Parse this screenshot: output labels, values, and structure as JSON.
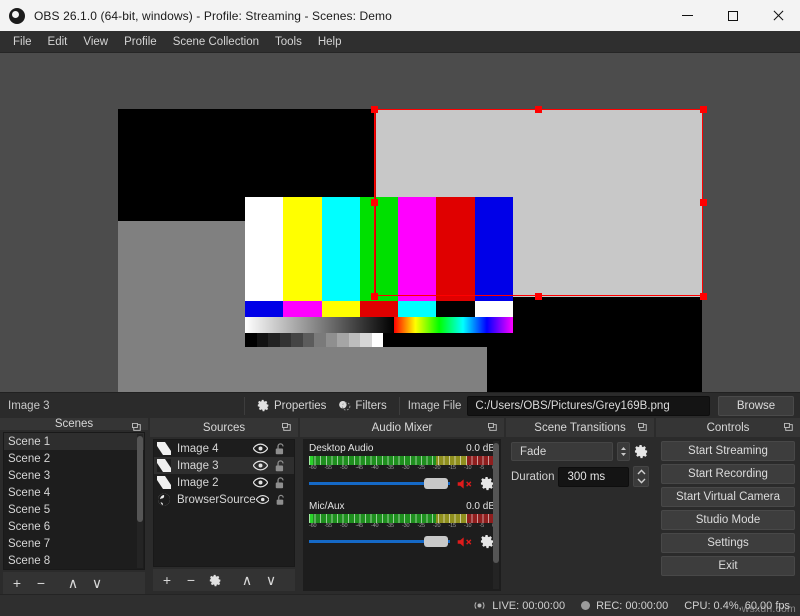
{
  "window": {
    "title": "OBS 26.1.0 (64-bit, windows) - Profile: Streaming - Scenes: Demo",
    "app_icon": "obs-logo-icon",
    "minimize_label": "—",
    "maximize_label": "□",
    "close_label": "✕"
  },
  "menubar": {
    "items": [
      {
        "label": "File"
      },
      {
        "label": "Edit"
      },
      {
        "label": "View"
      },
      {
        "label": "Profile"
      },
      {
        "label": "Scene Collection"
      },
      {
        "label": "Tools"
      },
      {
        "label": "Help"
      }
    ]
  },
  "source_toolbar": {
    "selected_source": "Image 3",
    "properties_label": "Properties",
    "filters_label": "Filters",
    "image_file_label": "Image File",
    "image_file_value": "C:/Users/OBS/Pictures/Grey169B.png",
    "browse_label": "Browse"
  },
  "scenes": {
    "title": "Scenes",
    "items": [
      {
        "label": "Scene 1",
        "selected": true
      },
      {
        "label": "Scene 2",
        "selected": false
      },
      {
        "label": "Scene 3",
        "selected": false
      },
      {
        "label": "Scene 4",
        "selected": false
      },
      {
        "label": "Scene 5",
        "selected": false
      },
      {
        "label": "Scene 6",
        "selected": false
      },
      {
        "label": "Scene 7",
        "selected": false
      },
      {
        "label": "Scene 8",
        "selected": false
      }
    ],
    "buttons": {
      "add": "+",
      "remove": "−",
      "up": "∧",
      "down": "∨"
    }
  },
  "sources": {
    "title": "Sources",
    "items": [
      {
        "label": "Image 4",
        "icon": "image-source-icon",
        "visible": true,
        "locked": false,
        "selected": false
      },
      {
        "label": "Image 3",
        "icon": "image-source-icon",
        "visible": true,
        "locked": false,
        "selected": true
      },
      {
        "label": "Image 2",
        "icon": "image-source-icon",
        "visible": true,
        "locked": false,
        "selected": false
      },
      {
        "label": "BrowserSource",
        "icon": "browser-source-icon",
        "visible": true,
        "locked": false,
        "selected": false
      }
    ],
    "buttons": {
      "add": "+",
      "remove": "−",
      "properties": "gear-icon",
      "up": "∧",
      "down": "∨"
    }
  },
  "audio_mixer": {
    "title": "Audio Mixer",
    "scale_labels": [
      "-60",
      "-55",
      "-50",
      "-45",
      "-40",
      "-35",
      "-30",
      "-25",
      "-20",
      "-15",
      "-10",
      "-5",
      "0"
    ],
    "tracks": [
      {
        "name": "Desktop Audio",
        "level": "0.0 dB",
        "muted": true,
        "volume_percent": 100
      },
      {
        "name": "Mic/Aux",
        "level": "0.0 dB",
        "muted": true,
        "volume_percent": 100
      }
    ]
  },
  "scene_transitions": {
    "title": "Scene Transitions",
    "transition_value": "Fade",
    "duration_label": "Duration",
    "duration_value": "300 ms"
  },
  "controls": {
    "title": "Controls",
    "buttons": [
      {
        "label": "Start Streaming"
      },
      {
        "label": "Start Recording"
      },
      {
        "label": "Start Virtual Camera"
      },
      {
        "label": "Studio Mode"
      },
      {
        "label": "Settings"
      },
      {
        "label": "Exit"
      }
    ]
  },
  "statusbar": {
    "live_label": "LIVE: 00:00:00",
    "rec_label": "REC: 00:00:00",
    "cpu_label": "CPU: 0.4%, 60.00 fps",
    "watermark": "wsxdn.com"
  },
  "colors": {
    "accent_red": "#ff0000",
    "fader_blue": "#1569c7",
    "titlebar_bg": "#f3f3f3",
    "panel_bg": "#2b2b2b",
    "list_bg": "#1d1d1d"
  }
}
